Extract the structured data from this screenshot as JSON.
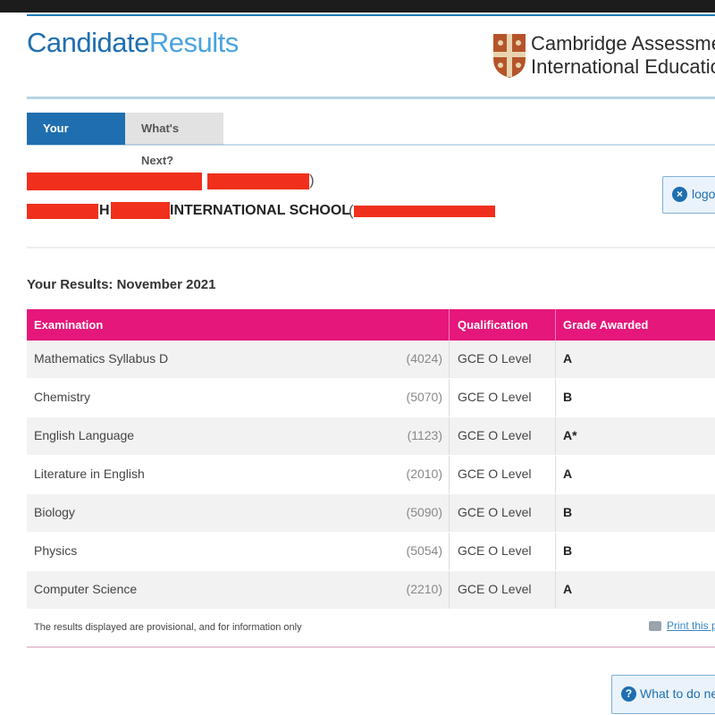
{
  "brand": {
    "part1": "Candidate",
    "part2": "Results"
  },
  "logo": {
    "line1": "Cambridge Assessment",
    "line2": "International Education"
  },
  "tabs": [
    {
      "label": "Your Results",
      "active": true
    },
    {
      "label": "What's Next?",
      "active": false
    }
  ],
  "candidate": {
    "name_redacted": true,
    "paren_close": ")",
    "school_prefix_fragment": "H",
    "school_name_visible": "INTERNATIONAL SCHOOL",
    "school_paren_open": "("
  },
  "logout_label": "logout",
  "results": {
    "title": "Your Results: November 2021",
    "columns": {
      "examination": "Examination",
      "qualification": "Qualification",
      "grade": "Grade Awarded"
    },
    "rows": [
      {
        "exam": "Mathematics Syllabus D",
        "code": "(4024)",
        "qualification": "GCE O Level",
        "grade": "A"
      },
      {
        "exam": "Chemistry",
        "code": "(5070)",
        "qualification": "GCE O Level",
        "grade": "B"
      },
      {
        "exam": "English Language",
        "code": "(1123)",
        "qualification": "GCE O Level",
        "grade": "A*"
      },
      {
        "exam": "Literature in English",
        "code": "(2010)",
        "qualification": "GCE O Level",
        "grade": "A"
      },
      {
        "exam": "Biology",
        "code": "(5090)",
        "qualification": "GCE O Level",
        "grade": "B"
      },
      {
        "exam": "Physics",
        "code": "(5054)",
        "qualification": "GCE O Level",
        "grade": "B"
      },
      {
        "exam": "Computer Science",
        "code": "(2210)",
        "qualification": "GCE O Level",
        "grade": "A"
      }
    ],
    "footnote": "The results displayed are provisional, and for information only",
    "print_label": "Print this page"
  },
  "what_next_label": "What to do next",
  "colors": {
    "brand_dark": "#1f6fb0",
    "brand_light": "#4aa3df",
    "header_pink": "#e5177a",
    "redaction": "#f0301c"
  },
  "icons": {
    "logout": "close-circle-icon",
    "what_next": "question-circle-icon",
    "print": "printer-icon",
    "logo": "crest-icon"
  }
}
